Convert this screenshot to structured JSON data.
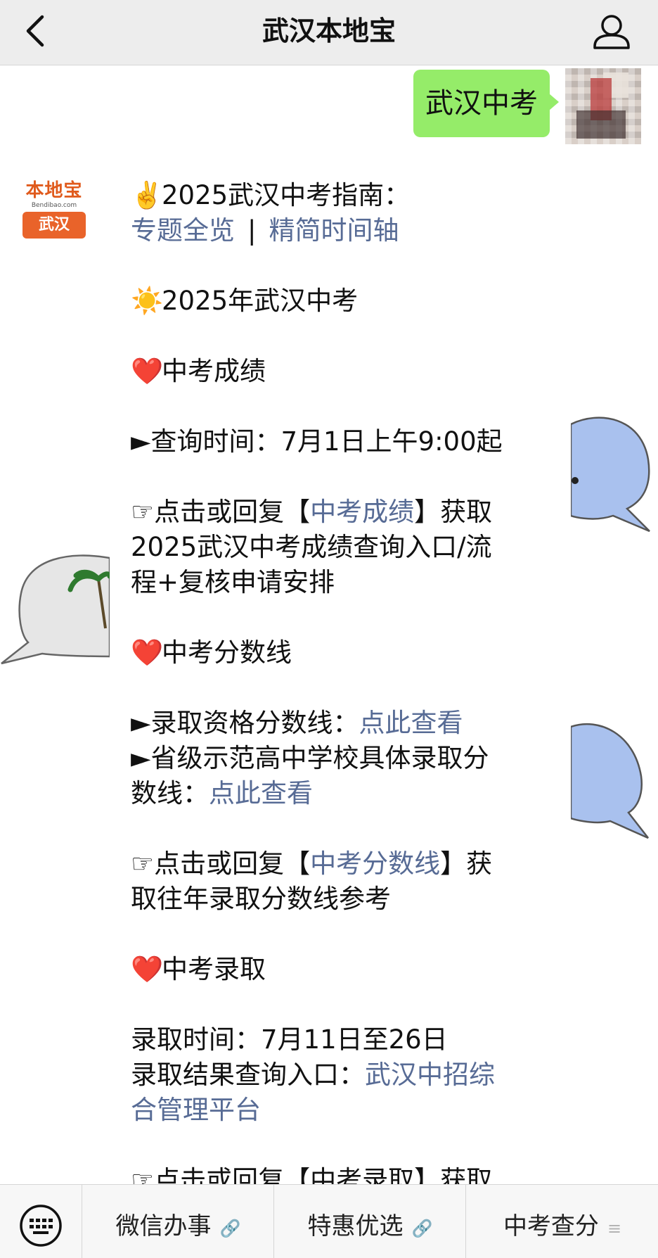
{
  "header": {
    "title": "武汉本地宝"
  },
  "chat": {
    "outgoing": {
      "text": "武汉中考"
    },
    "bot_avatar": {
      "logo_text": "本地宝",
      "logo_sub": "Bendibao.com",
      "logo_city": "武汉"
    },
    "message": {
      "guide_title": "2025武汉中考指南：",
      "guide_link_1": "专题全览",
      "guide_sep": "|",
      "guide_link_2": "精简时间轴",
      "section_main": "2025年武汉中考",
      "score_title": "中考成绩",
      "score_query_time": "►查询时间：7月1日上午9:00起",
      "score_reply_prefix": "☞点击或回复【",
      "score_reply_link": "中考成绩",
      "score_reply_suffix": "】获取",
      "score_reply_line2": "2025武汉中考成绩查询入口/流",
      "score_reply_line3": "程+复核申请安排",
      "line_title": "中考分数线",
      "line_qual_prefix": "►录取资格分数线：",
      "line_qual_link": "点此查看",
      "line_school_line1": "►省级示范高中学校具体录取分",
      "line_school_prefix": "数线：",
      "line_school_link": "点此查看",
      "line_reply_prefix": "☞点击或回复【",
      "line_reply_link": "中考分数线",
      "line_reply_suffix": "】获",
      "line_reply_line2": "取往年录取分数线参考",
      "admit_title": "中考录取",
      "admit_time": "录取时间：7月11日至26日",
      "admit_query_prefix": "录取结果查询入口：",
      "admit_query_link_1": "武汉中招综",
      "admit_query_link_2": "合管理平台",
      "cut_off_line": "☞点击或回复【中考录取】获取"
    }
  },
  "bottom_menu": {
    "items": [
      {
        "label": "微信办事",
        "icon": "link-icon"
      },
      {
        "label": "特惠优选",
        "icon": "link-icon"
      },
      {
        "label": "中考查分",
        "icon": "submenu-icon"
      }
    ]
  },
  "colors": {
    "header_bg": "#ededed",
    "bubble_out": "#95ec69",
    "link": "#576b95",
    "logo_orange": "#e9632a"
  }
}
